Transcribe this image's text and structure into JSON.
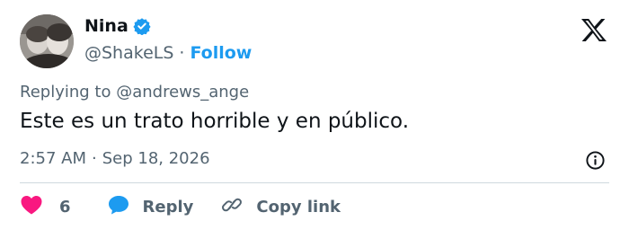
{
  "author": {
    "name": "Nina",
    "handle": "@ShakeLS",
    "separator": "·",
    "follow_label": "Follow",
    "verified": true
  },
  "tweet": {
    "replying_to": "Replying to @andrews_ange",
    "text": "Este es un trato horrible y en público.",
    "time": "2:57 AM",
    "date_separator": "·",
    "date": "Sep 18, 2026"
  },
  "actions": {
    "like_count": "6",
    "reply_label": "Reply",
    "copy_link_label": "Copy link"
  },
  "icons": {
    "verified": "verified-badge-icon",
    "platform": "x-logo-icon",
    "info": "info-icon",
    "like": "heart-icon",
    "reply": "speech-bubble-icon",
    "copy_link": "link-icon"
  },
  "colors": {
    "text": "#0f1419",
    "secondary": "#536471",
    "accent": "#1d9bf0",
    "like": "#f91880",
    "divider": "#cfd9de"
  }
}
